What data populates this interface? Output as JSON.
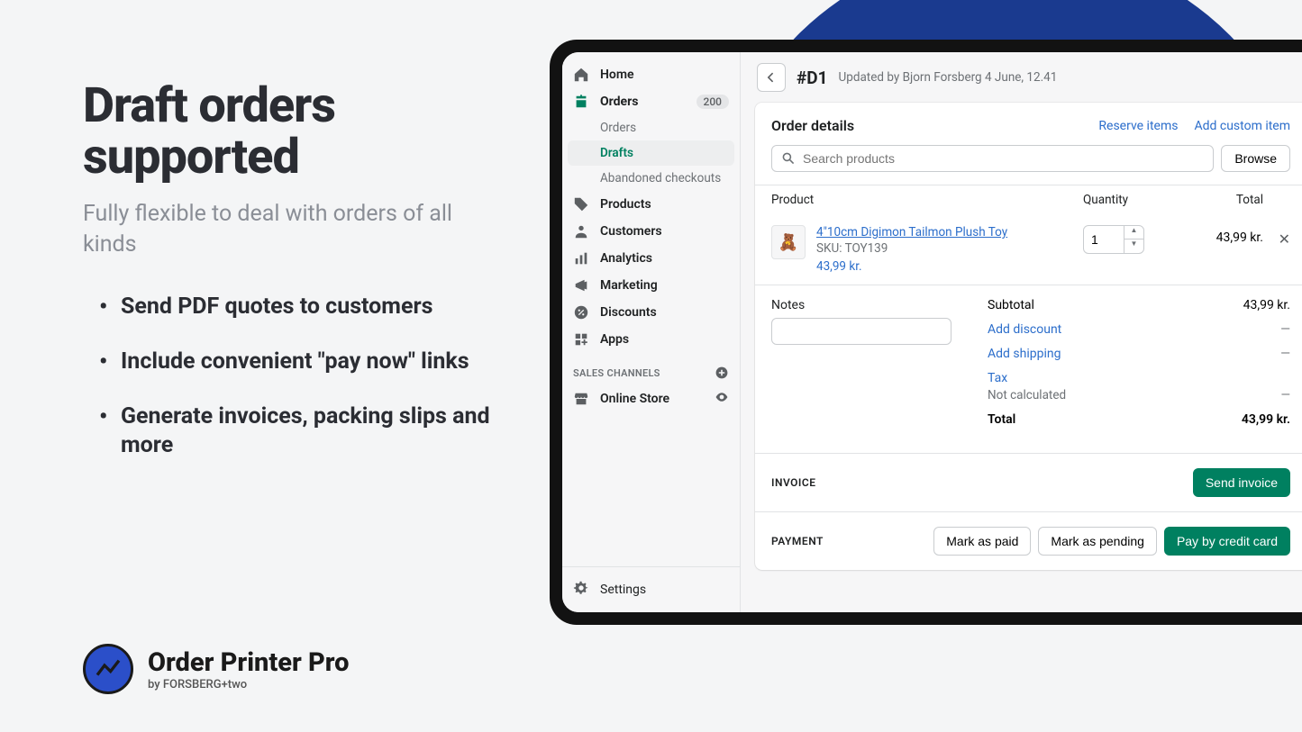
{
  "promo": {
    "headline": "Draft orders supported",
    "sub": "Fully flexible to deal with orders of all kinds",
    "bullets": [
      "Send PDF quotes to customers",
      "Include convenient  \"pay now\" links",
      "Generate invoices, packing slips and more"
    ]
  },
  "brand": {
    "name": "Order Printer Pro",
    "by": "by FORSBERG+two"
  },
  "sidebar": {
    "items": [
      {
        "label": "Home"
      },
      {
        "label": "Orders",
        "badge": "200"
      },
      {
        "label": "Orders"
      },
      {
        "label": "Drafts"
      },
      {
        "label": "Abandoned checkouts"
      },
      {
        "label": "Products"
      },
      {
        "label": "Customers"
      },
      {
        "label": "Analytics"
      },
      {
        "label": "Marketing"
      },
      {
        "label": "Discounts"
      },
      {
        "label": "Apps"
      }
    ],
    "channels_label": "SALES CHANNELS",
    "online_store": "Online Store",
    "settings": "Settings"
  },
  "header": {
    "draft_id": "#D1",
    "updated": "Updated by Bjorn Forsberg 4 June, 12.41"
  },
  "order": {
    "title": "Order details",
    "reserve": "Reserve items",
    "add_custom": "Add custom item",
    "search_placeholder": "Search products",
    "browse": "Browse",
    "cols": {
      "product": "Product",
      "qty": "Quantity",
      "total": "Total"
    },
    "line": {
      "name": "4\"10cm Digimon Tailmon Plush Toy",
      "sku": "SKU: TOY139",
      "price": "43,99 kr.",
      "qty": "1",
      "total": "43,99 kr."
    },
    "notes_label": "Notes",
    "summary": {
      "subtotal_label": "Subtotal",
      "subtotal": "43,99 kr.",
      "add_discount": "Add discount",
      "add_shipping": "Add shipping",
      "tax": "Tax",
      "not_calculated": "Not calculated",
      "total_label": "Total",
      "total": "43,99 kr."
    },
    "invoice_label": "INVOICE",
    "send_invoice": "Send invoice",
    "payment_label": "PAYMENT",
    "mark_paid": "Mark as paid",
    "mark_pending": "Mark as pending",
    "pay_card": "Pay by credit card"
  }
}
